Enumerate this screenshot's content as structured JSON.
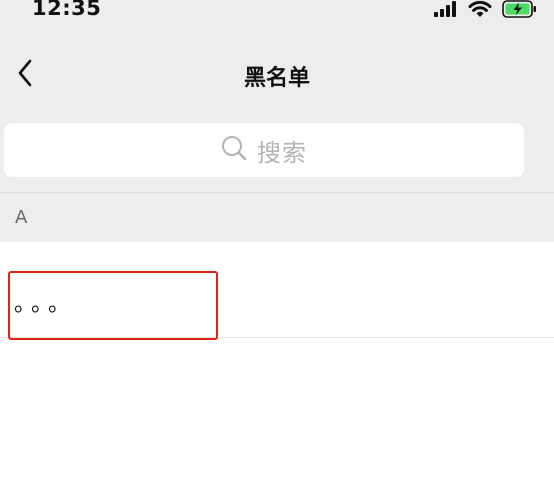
{
  "status_bar": {
    "time": "12:35",
    "icons": [
      "signal-icon",
      "wifi-icon",
      "battery-charging-icon"
    ]
  },
  "nav": {
    "title": "黑名单",
    "back_icon": "chevron-left-icon"
  },
  "search": {
    "placeholder": "搜索",
    "icon": "search-icon"
  },
  "list": {
    "section_letter": "A",
    "items": [
      {
        "label": "。。。"
      }
    ]
  },
  "colors": {
    "background_top": "#ededed",
    "list_background": "#ffffff",
    "highlight_border": "#e2231a",
    "battery_fill": "#4cd964"
  }
}
